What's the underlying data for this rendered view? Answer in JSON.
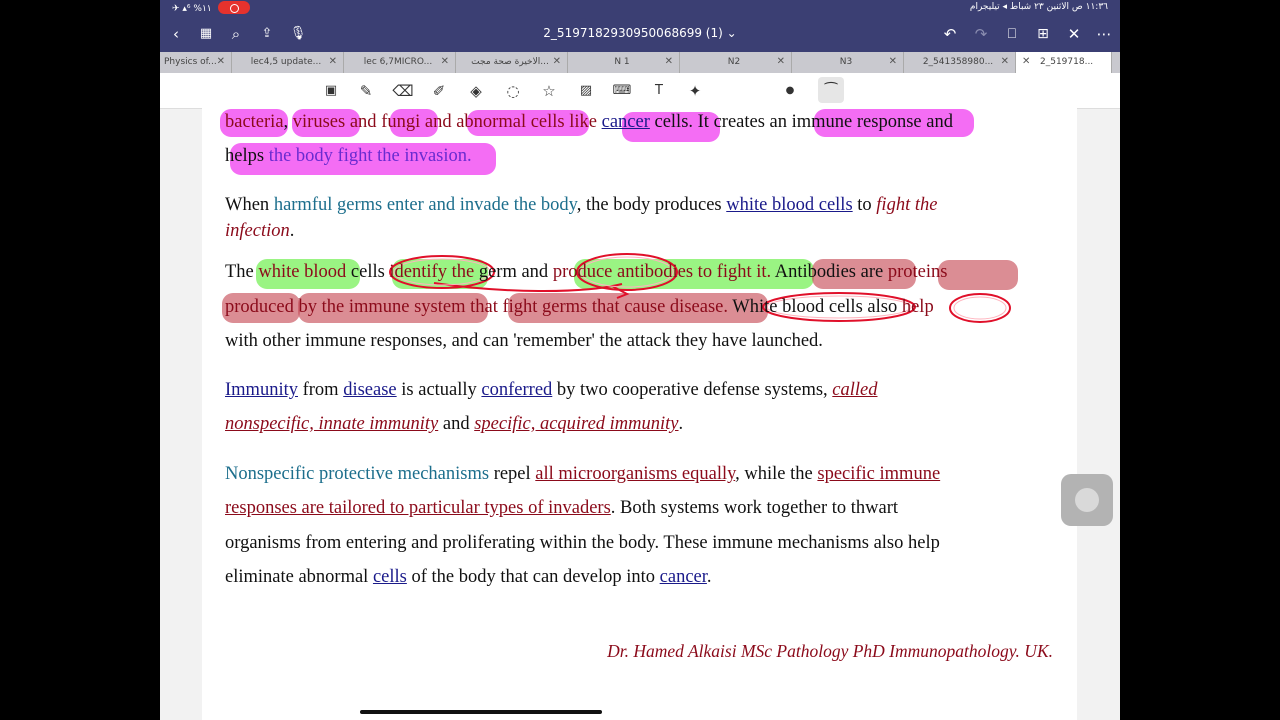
{
  "status_bar": {
    "left": "✈︎ ▴⁶ %١١",
    "right": "١١:٣٦ ص  الاثنين ٢٣ شباط    ◂ تيليجرام"
  },
  "title_bar": {
    "title": "2_5197182930950068699 (1) ⌄"
  },
  "tabs": [
    {
      "label": "Physics of..."
    },
    {
      "label": "lec4,5 update..."
    },
    {
      "label": "lec 6,7MICRO..."
    },
    {
      "label": "الاخيرة صحة مجت..."
    },
    {
      "label": "N 1"
    },
    {
      "label": "N2"
    },
    {
      "label": "N3"
    },
    {
      "label": "2_541358980..."
    },
    {
      "label": "2_519718..."
    }
  ],
  "document": {
    "p1": {
      "a": "bacteria",
      "b": ", ",
      "c": "viruses",
      "d": " and ",
      "e": "fungi",
      "f": " and ",
      "g": "abnormal cells",
      "h": " like ",
      "i": "cancer",
      "j": " cells. It creates ",
      "k": "an immune response",
      "l": " and",
      "m": "helps ",
      "n": "the body fight the invasion."
    },
    "p2": {
      "a": "When ",
      "b": "harmful germs enter and invade the body",
      "c": ", the body produces ",
      "d": "white blood cells",
      "e": " to ",
      "f": "fight the",
      "g": "infection",
      "h": "."
    },
    "p3": {
      "a": "The ",
      "b": "white blood",
      "c": " cells ",
      "d": "identify the",
      "e": " germ and ",
      "f": "produce antibodies to fight it.",
      "g": " Antibodies",
      "h": " are ",
      "i": "proteins",
      "j": "produced",
      "k": " by the immune system",
      "l": " that fight germs that cause disease.",
      "m": " White blood cells",
      "n": " also ",
      "o": "help",
      "p": "with other immune responses, and can 'remember' the attack they have launched."
    },
    "p4": {
      "a": "Immunity",
      "b": " from ",
      "c": "disease",
      "d": " is actually ",
      "e": "conferred",
      "f": " by two cooperative defense systems, ",
      "g": "called",
      "h": "nonspecific, innate immunity",
      "i": " and ",
      "j": "specific, acquired immunity",
      "k": "."
    },
    "p5": {
      "a": "Nonspecific protective mechanisms",
      "b": " repel ",
      "c": "all microorganisms equally",
      "d": ", while the ",
      "e": "specific immune",
      "f": "responses are tailored to particular types of invaders",
      "g": ". Both systems work together to thwart",
      "h": "organisms from entering and proliferating within the body. These immune mechanisms also help",
      "i": "eliminate abnormal ",
      "j": "cells",
      "k": " of the body that can develop into ",
      "l": "cancer",
      "m": "."
    },
    "signature": "Dr. Hamed Alkaisi MSc Pathology PhD Immunopathology. UK."
  },
  "colors": {
    "bar": "#3b3f73",
    "pink_highlight": "#f03cf0",
    "green_highlight": "#78f05a",
    "rose_highlight": "#c8505a"
  }
}
